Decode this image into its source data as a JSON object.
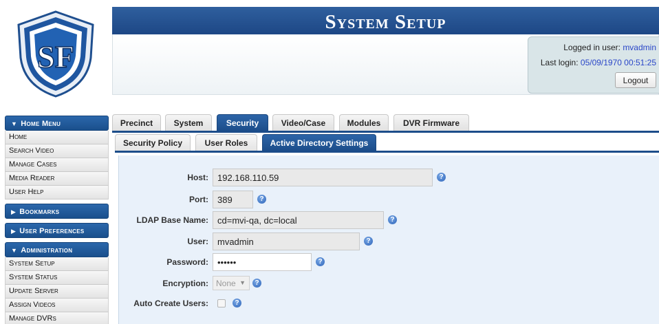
{
  "banner": {
    "title": "System Setup"
  },
  "logo": {
    "letters": "SF"
  },
  "login": {
    "user_label": "Logged in user:",
    "user_value": "mvadmin",
    "last_label": "Last login:",
    "last_value": "05/09/1970 00:51:25",
    "logout_label": "Logout"
  },
  "sidebar": {
    "home_menu": "Home Menu",
    "home_items": [
      "Home",
      "Search Video",
      "Manage Cases",
      "Media Reader",
      "User Help"
    ],
    "bookmarks": "Bookmarks",
    "user_prefs": "User Preferences",
    "administration": "Administration",
    "admin_items": [
      "System Setup",
      "System Status",
      "Update Server",
      "Assign Videos",
      "Manage DVRs"
    ]
  },
  "tabs": [
    "Precinct",
    "System",
    "Security",
    "Video/Case",
    "Modules",
    "DVR Firmware"
  ],
  "subtabs": [
    "Security Policy",
    "User Roles",
    "Active Directory Settings"
  ],
  "form": {
    "host_label": "Host:",
    "host_value": "192.168.110.59",
    "port_label": "Port:",
    "port_value": "389",
    "base_label": "LDAP Base Name:",
    "base_value": "cd=mvi-qa, dc=local",
    "user_label": "User:",
    "user_value": "mvadmin",
    "password_label": "Password:",
    "password_value": "••••••",
    "encryption_label": "Encryption:",
    "encryption_value": "None",
    "autocreate_label": "Auto Create Users:"
  },
  "colors": {
    "accent": "#1c4d8a",
    "help_icon": "#2c63b8",
    "link": "#2a46c8"
  }
}
